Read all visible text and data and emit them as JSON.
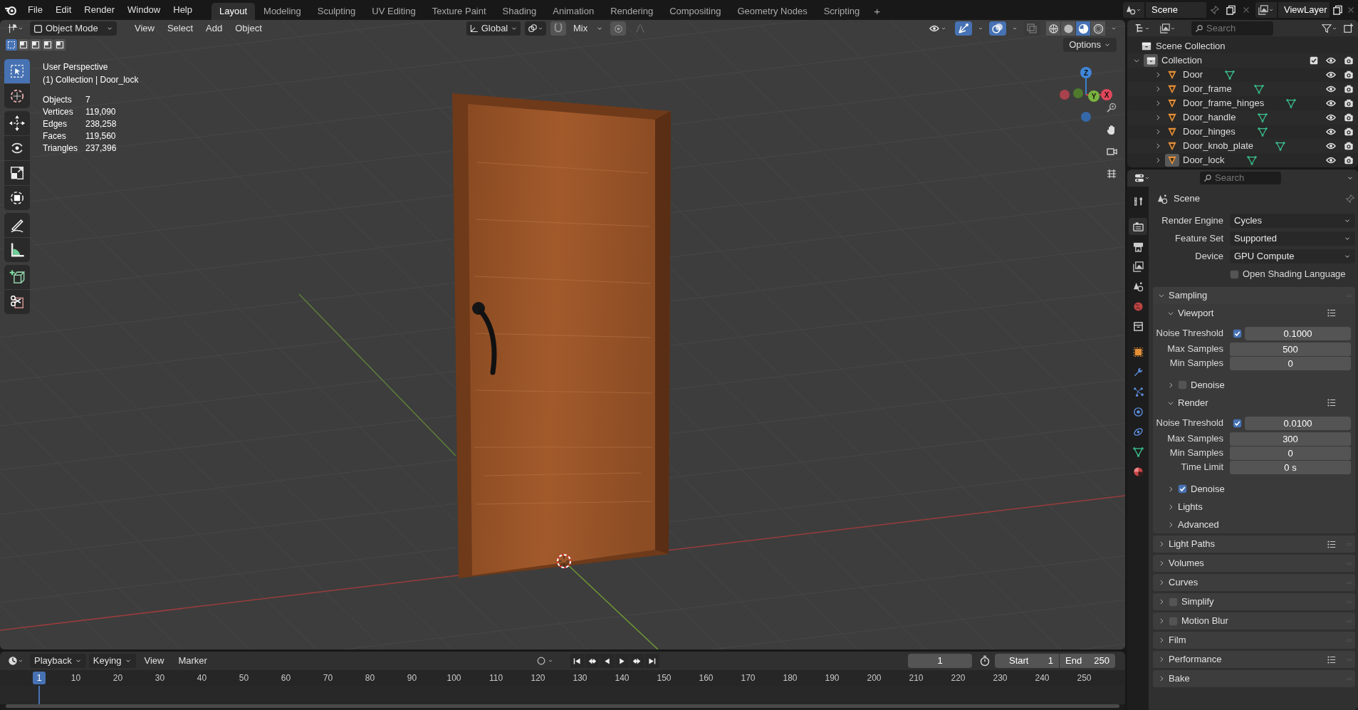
{
  "top_bar": {
    "menus": [
      "File",
      "Edit",
      "Render",
      "Window",
      "Help"
    ],
    "workspaces": [
      {
        "label": "Layout",
        "selected": true
      },
      {
        "label": "Modeling",
        "selected": false
      },
      {
        "label": "Sculpting",
        "selected": false
      },
      {
        "label": "UV Editing",
        "selected": false
      },
      {
        "label": "Texture Paint",
        "selected": false
      },
      {
        "label": "Shading",
        "selected": false
      },
      {
        "label": "Animation",
        "selected": false
      },
      {
        "label": "Rendering",
        "selected": false
      },
      {
        "label": "Compositing",
        "selected": false
      },
      {
        "label": "Geometry Nodes",
        "selected": false
      },
      {
        "label": "Scripting",
        "selected": false
      }
    ],
    "add_workspace": "+",
    "scene": "Scene",
    "view_layer": "ViewLayer"
  },
  "viewport": {
    "mode": "Object Mode",
    "menus": [
      "View",
      "Select",
      "Add",
      "Object"
    ],
    "orientation": "Global",
    "snap_target": "Mix",
    "options": "Options",
    "select_modes": [
      {
        "selected": true
      },
      {
        "selected": false
      },
      {
        "selected": false
      },
      {
        "selected": false
      },
      {
        "selected": false
      }
    ],
    "toggles": [
      {
        "kind": "gizmo",
        "on": true
      },
      {
        "kind": "overlays",
        "on": true
      },
      {
        "kind": "xray",
        "on": false
      }
    ],
    "shading_modes": [
      {
        "kind": "wireframe",
        "selected": false
      },
      {
        "kind": "solid",
        "selected": false
      },
      {
        "kind": "material",
        "selected": true
      },
      {
        "kind": "rendered",
        "selected": false
      }
    ],
    "tool_groups": [
      [
        {
          "kind": "select_box",
          "selected": true
        },
        {
          "kind": "cursor",
          "selected": false
        }
      ],
      [
        {
          "kind": "move",
          "selected": false
        },
        {
          "kind": "rotate",
          "selected": false
        },
        {
          "kind": "scale",
          "selected": false
        },
        {
          "kind": "transform",
          "selected": false
        }
      ],
      [
        {
          "kind": "annotate",
          "selected": false
        },
        {
          "kind": "measure",
          "selected": false
        }
      ],
      [
        {
          "kind": "add_cube",
          "selected": false
        },
        {
          "kind": "cut",
          "selected": false
        }
      ]
    ],
    "view_name": "User Perspective",
    "context": "(1) Collection | Door_lock",
    "stats": [
      {
        "label": "Objects",
        "value": "7"
      },
      {
        "label": "Vertices",
        "value": "119,090"
      },
      {
        "label": "Edges",
        "value": "238,258"
      },
      {
        "label": "Faces",
        "value": "119,560"
      },
      {
        "label": "Triangles",
        "value": "237,396"
      }
    ],
    "gizmo_axes": [
      "X",
      "Y",
      "Z"
    ]
  },
  "outliner": {
    "search_placeholder": "Search",
    "root": "Scene Collection",
    "collections": [
      {
        "label": "Collection",
        "expanded": true,
        "checked": true,
        "children": [
          {
            "label": "Door",
            "selected": false
          },
          {
            "label": "Door_frame",
            "selected": false
          },
          {
            "label": "Door_frame_hinges",
            "selected": false
          },
          {
            "label": "Door_handle",
            "selected": false
          },
          {
            "label": "Door_hinges",
            "selected": false
          },
          {
            "label": "Door_knob_plate",
            "selected": false
          },
          {
            "label": "Door_lock",
            "selected": true
          }
        ]
      }
    ]
  },
  "properties": {
    "search_placeholder": "Search",
    "context": "Scene",
    "tabs": [
      {
        "kind": "tool",
        "selected": false
      },
      {
        "kind": "render",
        "selected": true
      },
      {
        "kind": "output",
        "selected": false
      },
      {
        "kind": "view_layer",
        "selected": false
      },
      {
        "kind": "scene",
        "selected": false
      },
      {
        "kind": "world",
        "selected": false
      },
      {
        "kind": "collection",
        "selected": false
      },
      {
        "kind": "object",
        "selected": false
      },
      {
        "kind": "modifiers",
        "selected": false
      },
      {
        "kind": "particles",
        "selected": false
      },
      {
        "kind": "physics",
        "selected": false
      },
      {
        "kind": "constraints",
        "selected": false
      },
      {
        "kind": "data",
        "selected": false
      },
      {
        "kind": "material",
        "selected": false
      }
    ],
    "fields": [
      {
        "label": "Render Engine",
        "value": "Cycles"
      },
      {
        "label": "Feature Set",
        "value": "Supported"
      },
      {
        "label": "Device",
        "value": "GPU Compute"
      }
    ],
    "osl": {
      "label": "Open Shading Language",
      "checked": false
    },
    "rows": [
      {
        "kind": "panel",
        "label": "Sampling",
        "expanded": true
      },
      {
        "kind": "subpanel",
        "label": "Viewport",
        "expanded": true,
        "presets": true
      },
      {
        "kind": "check_number",
        "label": "Noise Threshold",
        "checked": true,
        "value": "0.1000"
      },
      {
        "kind": "number",
        "label": "Max Samples",
        "value": "500"
      },
      {
        "kind": "number",
        "label": "Min Samples",
        "value": "0"
      },
      {
        "kind": "subpanel",
        "label": "Denoise",
        "expanded": false,
        "checked": false
      },
      {
        "kind": "subpanel",
        "label": "Render",
        "expanded": true,
        "presets": true
      },
      {
        "kind": "check_number",
        "label": "Noise Threshold",
        "checked": true,
        "value": "0.0100"
      },
      {
        "kind": "number",
        "label": "Max Samples",
        "value": "300"
      },
      {
        "kind": "number",
        "label": "Min Samples",
        "value": "0"
      },
      {
        "kind": "number",
        "label": "Time Limit",
        "value": "0 s"
      },
      {
        "kind": "subpanel",
        "label": "Denoise",
        "expanded": false,
        "checked": true
      },
      {
        "kind": "subpanel",
        "label": "Lights",
        "expanded": false
      },
      {
        "kind": "subpanel",
        "label": "Advanced",
        "expanded": false
      },
      {
        "kind": "panel",
        "label": "Light Paths",
        "expanded": false,
        "presets": true
      },
      {
        "kind": "panel",
        "label": "Volumes",
        "expanded": false
      },
      {
        "kind": "panel",
        "label": "Curves",
        "expanded": false
      },
      {
        "kind": "panel",
        "label": "Simplify",
        "expanded": false,
        "checked": false
      },
      {
        "kind": "panel",
        "label": "Motion Blur",
        "expanded": false,
        "checked": false
      },
      {
        "kind": "panel",
        "label": "Film",
        "expanded": false
      },
      {
        "kind": "panel",
        "label": "Performance",
        "expanded": false,
        "presets": true
      },
      {
        "kind": "panel",
        "label": "Bake",
        "expanded": false
      }
    ]
  },
  "timeline": {
    "menus": [
      "Playback",
      "Keying",
      "View",
      "Marker"
    ],
    "current_frame": "1",
    "start_label": "Start",
    "start": "1",
    "end_label": "End",
    "end": "250",
    "playhead": "1",
    "ruler": [
      "10",
      "20",
      "30",
      "40",
      "50",
      "60",
      "70",
      "80",
      "90",
      "100",
      "110",
      "120",
      "130",
      "140",
      "150",
      "160",
      "170",
      "180",
      "190",
      "200",
      "210",
      "220",
      "230",
      "240",
      "250"
    ]
  }
}
